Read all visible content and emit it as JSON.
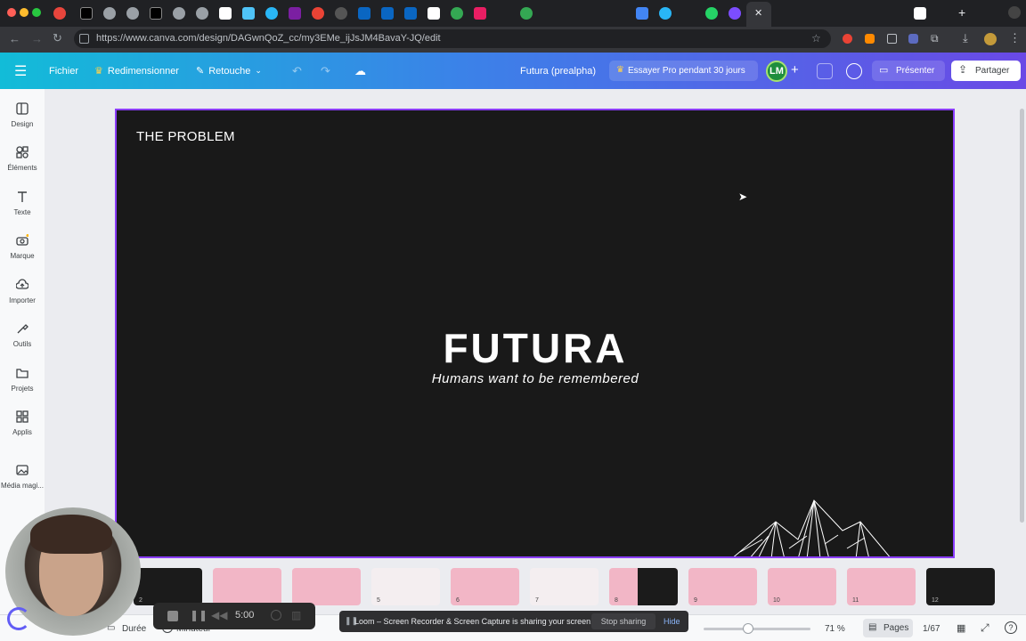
{
  "browser": {
    "url": "https://www.canva.com/design/DAGwnQoZ_cc/my3EMe_ijJsJM4BavaY-JQ/edit"
  },
  "toolbar": {
    "file_label": "Fichier",
    "resize_label": "Redimensionner",
    "edit_label": "Retouche",
    "doc_title": "Futura (prealpha)",
    "try_pro_label": "Essayer Pro pendant 30 jours",
    "avatar_initials": "LM",
    "present_label": "Présenter",
    "share_label": "Partager"
  },
  "sidebar": {
    "items": [
      {
        "label": "Design",
        "icon": "design-icon"
      },
      {
        "label": "Éléments",
        "icon": "elements-icon"
      },
      {
        "label": "Texte",
        "icon": "text-icon"
      },
      {
        "label": "Marque",
        "icon": "brand-icon"
      },
      {
        "label": "Importer",
        "icon": "upload-icon"
      },
      {
        "label": "Outils",
        "icon": "tools-icon"
      },
      {
        "label": "Projets",
        "icon": "folder-icon"
      },
      {
        "label": "Applis",
        "icon": "apps-icon"
      },
      {
        "label": "Média magi...",
        "icon": "magic-media-icon"
      }
    ]
  },
  "slide": {
    "heading": "THE PROBLEM",
    "title": "FUTURA",
    "subtitle": "Humans want to be remembered"
  },
  "thumbnails": [
    {
      "num": "2",
      "style": "dark"
    },
    {
      "num": "",
      "style": "pink"
    },
    {
      "num": "",
      "style": "pink"
    },
    {
      "num": "5",
      "style": "light"
    },
    {
      "num": "6",
      "style": "pink"
    },
    {
      "num": "7",
      "style": "light"
    },
    {
      "num": "8",
      "style": "pink-dark"
    },
    {
      "num": "9",
      "style": "pink"
    },
    {
      "num": "10",
      "style": "pink"
    },
    {
      "num": "11",
      "style": "pink"
    },
    {
      "num": "12",
      "style": "dark"
    }
  ],
  "statusbar": {
    "duration_label": "Durée",
    "timer_label": "Minuteur",
    "zoom": "71 %",
    "pages_label": "Pages",
    "page_counter": "1/67"
  },
  "loom": {
    "time": "5:00"
  },
  "share_notice": {
    "text": "Loom – Screen Recorder & Screen Capture is sharing your screen.",
    "stop_label": "Stop sharing",
    "hide_label": "Hide"
  },
  "colors": {
    "accent": "#8b3dff",
    "slide_bg": "#191919",
    "thumb_pink": "#f2b6c6"
  }
}
